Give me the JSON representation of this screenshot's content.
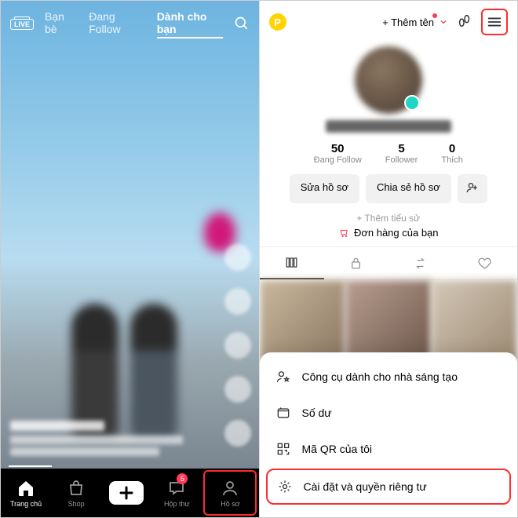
{
  "left": {
    "tabs": {
      "friends": "Bạn bè",
      "following": "Đang Follow",
      "foryou": "Dành cho bạn"
    },
    "nav": {
      "home": "Trang chủ",
      "shop": "Shop",
      "inbox": "Hộp thư",
      "profile": "Hồ sơ",
      "inbox_badge": "5"
    }
  },
  "right": {
    "header": {
      "add_name": "+ Thêm tên",
      "coin": "P"
    },
    "stats": {
      "following_n": "50",
      "following_l": "Đang Follow",
      "followers_n": "5",
      "followers_l": "Follower",
      "likes_n": "0",
      "likes_l": "Thích"
    },
    "buttons": {
      "edit": "Sửa hồ sơ",
      "share": "Chia sẻ hồ sơ"
    },
    "add_bio": "+ Thêm tiểu sử",
    "orders": "Đơn hàng của bạn",
    "sheet": {
      "creator": "Công cụ dành cho nhà sáng tạo",
      "balance": "Số dư",
      "qr": "Mã QR của tôi",
      "settings": "Cài đặt và quyền riêng tư"
    }
  }
}
